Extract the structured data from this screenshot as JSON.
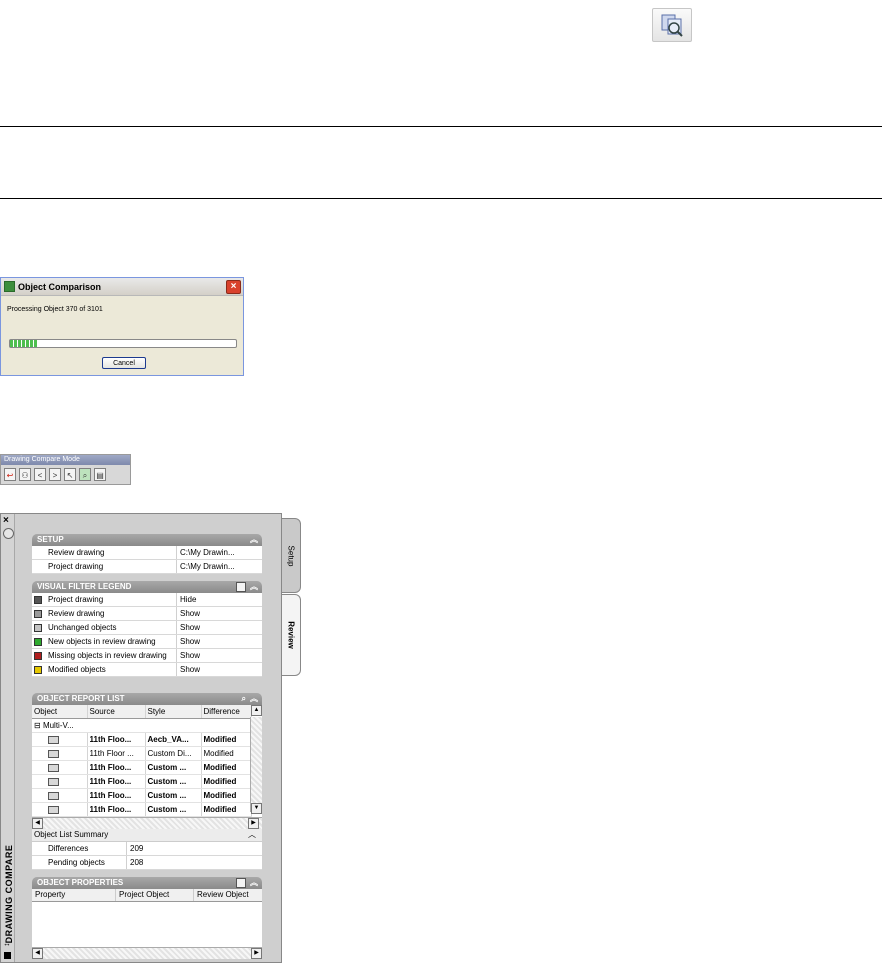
{
  "dialog": {
    "title": "Object Comparison",
    "message": "Processing Object 370 of 3101",
    "progress_fraction": 0.12,
    "cancel_label": "Cancel"
  },
  "toolbar": {
    "title": "Drawing Compare Mode",
    "buttons": [
      {
        "icon": "exit-compare-icon"
      },
      {
        "icon": "users-icon"
      },
      {
        "icon": "previous-icon",
        "glyph": "<"
      },
      {
        "icon": "next-icon",
        "glyph": ">"
      },
      {
        "icon": "pointer-icon"
      },
      {
        "icon": "zoom-icon"
      },
      {
        "icon": "report-icon"
      }
    ]
  },
  "palette": {
    "title": "DRAWING COMPARE",
    "tabs": [
      "Setup",
      "Review"
    ],
    "setup": {
      "header": "SETUP",
      "rows": [
        {
          "label": "Review drawing",
          "value": "C:\\My Drawin..."
        },
        {
          "label": "Project drawing",
          "value": "C:\\My Drawin..."
        }
      ]
    },
    "legend": {
      "header": "VISUAL FILTER LEGEND",
      "rows": [
        {
          "label": "Project drawing",
          "value": "Hide",
          "color": "#555555"
        },
        {
          "label": "Review drawing",
          "value": "Show",
          "color": "#9a9a9a"
        },
        {
          "label": "Unchanged objects",
          "value": "Show",
          "color": "#c4c4c4"
        },
        {
          "label": "New objects in review drawing",
          "value": "Show",
          "color": "#2faa2f"
        },
        {
          "label": "Missing objects in review drawing",
          "value": "Show",
          "color": "#b01e1e"
        },
        {
          "label": "Modified objects",
          "value": "Show",
          "color": "#e6c800"
        }
      ]
    },
    "report": {
      "header": "OBJECT REPORT LIST",
      "columns": [
        "Object",
        "Source",
        "Style",
        "Difference"
      ],
      "group": "Multi-V...",
      "rows": [
        {
          "source": "11th Floo...",
          "style": "Aecb_VA...",
          "diff": "Modified",
          "bold": true
        },
        {
          "source": "11th Floor ...",
          "style": "Custom Di...",
          "diff": "Modified",
          "bold": false
        },
        {
          "source": "11th Floo...",
          "style": "Custom ...",
          "diff": "Modified",
          "bold": true
        },
        {
          "source": "11th Floo...",
          "style": "Custom ...",
          "diff": "Modified",
          "bold": true
        },
        {
          "source": "11th Floo...",
          "style": "Custom ...",
          "diff": "Modified",
          "bold": true
        },
        {
          "source": "11th Floo...",
          "style": "Custom ...",
          "diff": "Modified",
          "bold": true
        }
      ]
    },
    "summary": {
      "header": "Object List Summary",
      "rows": [
        {
          "label": "Differences",
          "value": "209"
        },
        {
          "label": "Pending objects",
          "value": "208"
        }
      ]
    },
    "properties": {
      "header": "OBJECT PROPERTIES",
      "columns": [
        "Property",
        "Project Object",
        "Review Object"
      ]
    }
  }
}
